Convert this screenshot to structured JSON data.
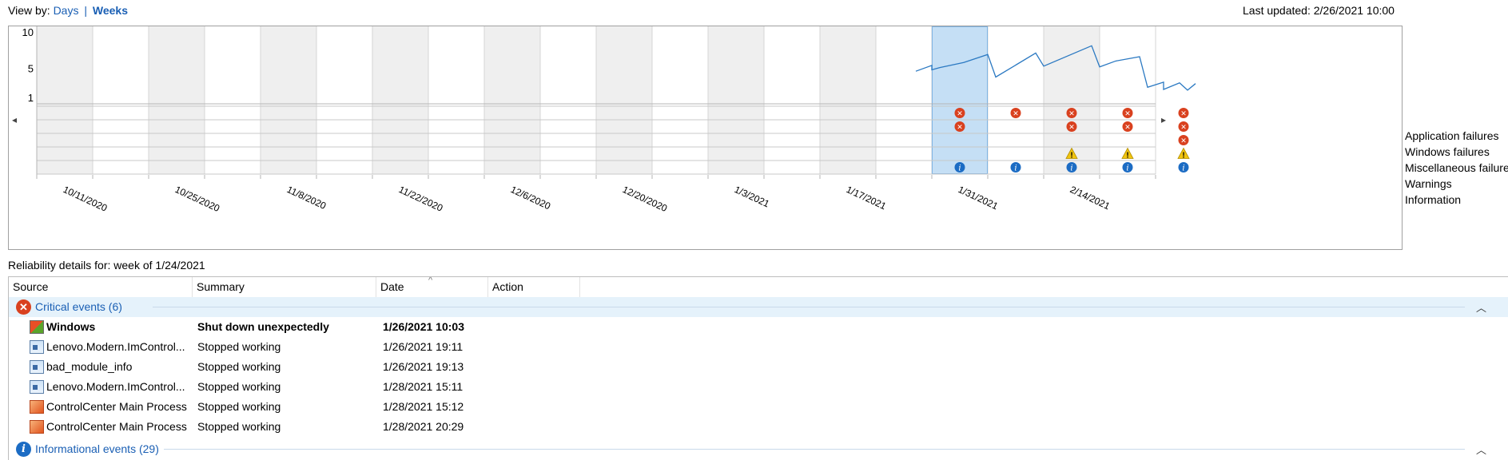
{
  "view_by": {
    "label": "View by:",
    "days": "Days",
    "separator": "|",
    "weeks": "Weeks"
  },
  "last_updated": "Last updated: 2/26/2021 10:00",
  "chart": {
    "y_ticks": [
      "10",
      "5",
      "1"
    ],
    "x_labels": [
      "10/11/2020",
      "10/25/2020",
      "11/8/2020",
      "11/22/2020",
      "12/6/2020",
      "12/20/2020",
      "1/3/2021",
      "1/17/2021",
      "1/31/2021",
      "2/14/2021"
    ],
    "selected_week": "1/24/2021",
    "categories": [
      "Application failures",
      "Windows failures",
      "Miscellaneous failures",
      "Warnings",
      "Information"
    ],
    "nav_left": "◂",
    "nav_right": "▸",
    "colors": {
      "line": "#2b79c2",
      "selected": "#c5dff5",
      "shade": "#efefef",
      "critical": "#d9411f",
      "warning": "#f1c40f",
      "info": "#1c6cc4"
    }
  },
  "chart_data": {
    "type": "line",
    "title": "",
    "x_label": "",
    "y_label": "",
    "y_range": [
      1,
      10
    ],
    "stability_index": [
      {
        "x": "1/22/2021",
        "y": 4.6
      },
      {
        "x": "1/24/2021",
        "y": 5.4
      },
      {
        "x": "1/24/2021",
        "y": 4.8
      },
      {
        "x": "1/25/2021",
        "y": 5.1
      },
      {
        "x": "1/28/2021",
        "y": 5.8
      },
      {
        "x": "1/31/2021",
        "y": 6.9
      },
      {
        "x": "2/1/2021",
        "y": 3.8
      },
      {
        "x": "2/6/2021",
        "y": 7.1
      },
      {
        "x": "2/7/2021",
        "y": 5.3
      },
      {
        "x": "2/13/2021",
        "y": 8.1
      },
      {
        "x": "2/14/2021",
        "y": 5.2
      },
      {
        "x": "2/16/2021",
        "y": 6.0
      },
      {
        "x": "2/19/2021",
        "y": 6.6
      },
      {
        "x": "2/20/2021",
        "y": 2.4
      },
      {
        "x": "2/22/2021",
        "y": 3.1
      },
      {
        "x": "2/22/2021",
        "y": 2.1
      },
      {
        "x": "2/24/2021",
        "y": 3.0
      },
      {
        "x": "2/25/2021",
        "y": 2.0
      },
      {
        "x": "2/26/2021",
        "y": 2.9
      }
    ],
    "events": {
      "Application failures": [
        "1/24/2021",
        "1/31/2021",
        "2/7/2021",
        "2/14/2021",
        "2/21/2021"
      ],
      "Windows failures": [
        "1/24/2021",
        "2/7/2021",
        "2/14/2021",
        "2/21/2021"
      ],
      "Miscellaneous failures": [
        "2/21/2021"
      ],
      "Warnings": [
        "2/7/2021",
        "2/14/2021",
        "2/21/2021"
      ],
      "Information": [
        "1/24/2021",
        "1/31/2021",
        "2/7/2021",
        "2/14/2021",
        "2/21/2021"
      ]
    }
  },
  "details_label": "Reliability details for: week of 1/24/2021",
  "table": {
    "columns": [
      "Source",
      "Summary",
      "Date",
      "Action"
    ],
    "critical_group": "Critical events (6)",
    "info_group": "Informational events (29)",
    "rows": [
      {
        "source": "Windows",
        "summary": "Shut down unexpectedly",
        "date": "1/26/2021 10:03",
        "icon": "windows-icon"
      },
      {
        "source": "Lenovo.Modern.ImControl...",
        "summary": "Stopped working",
        "date": "1/26/2021 19:11",
        "icon": "app-icon"
      },
      {
        "source": "bad_module_info",
        "summary": "Stopped working",
        "date": "1/26/2021 19:13",
        "icon": "app-icon"
      },
      {
        "source": "Lenovo.Modern.ImControl...",
        "summary": "Stopped working",
        "date": "1/28/2021 15:11",
        "icon": "app-icon"
      },
      {
        "source": "ControlCenter Main Process",
        "summary": "Stopped working",
        "date": "1/28/2021 15:12",
        "icon": "controlcenter-icon"
      },
      {
        "source": "ControlCenter Main Process",
        "summary": "Stopped working",
        "date": "1/28/2021 20:29",
        "icon": "controlcenter-icon"
      }
    ]
  }
}
